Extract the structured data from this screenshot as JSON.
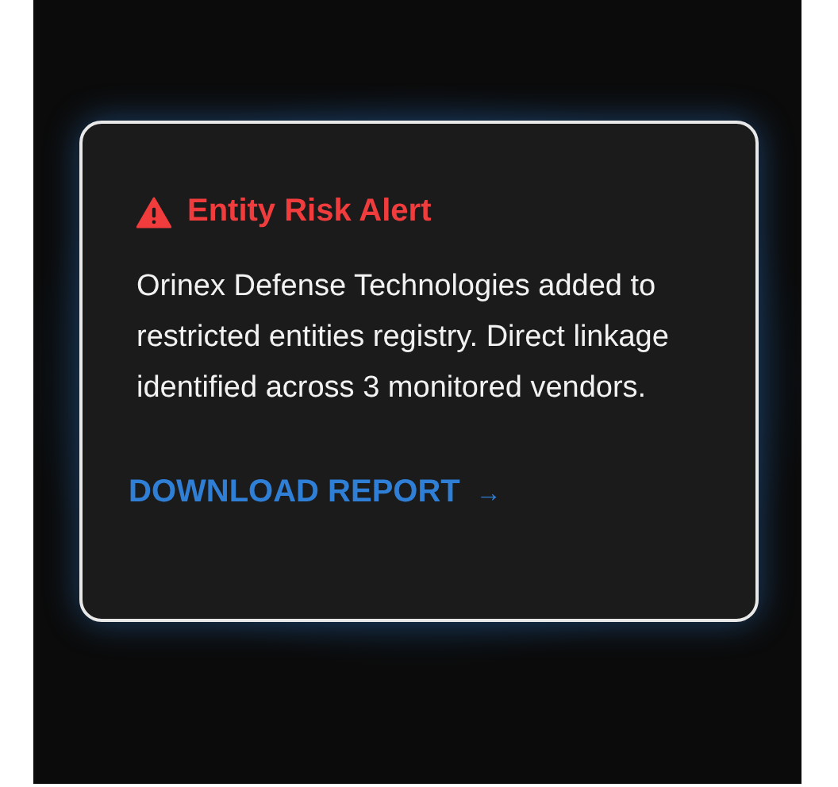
{
  "alert": {
    "title": "Entity Risk Alert",
    "message": "Orinex Defense Technologies added to restricted entities registry. Direct linkage identified across 3 monitored vendors.",
    "action": {
      "label": "DOWNLOAD REPORT",
      "arrow": "→"
    }
  }
}
